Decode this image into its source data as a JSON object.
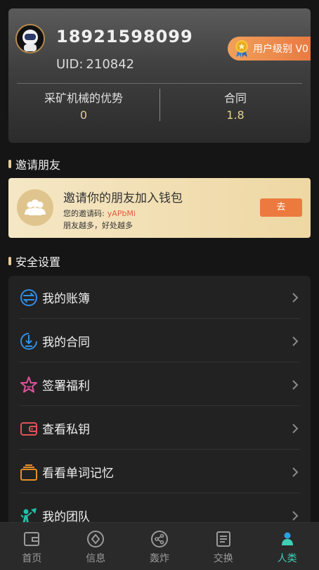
{
  "profile": {
    "phone": "18921598099",
    "uid_label": "UID:",
    "uid": "210842",
    "level_badge": "用户级别 V0",
    "stats": [
      {
        "title": "采矿机械的优势",
        "value": "0"
      },
      {
        "title": "合同",
        "value": "1.8"
      }
    ]
  },
  "invite_section": {
    "title": "邀请朋友",
    "headline": "邀请你的朋友加入钱包",
    "code_label": "您的邀请码:",
    "code": "yAPbMi",
    "note": "朋友越多，好处越多",
    "button": "去"
  },
  "security_section": {
    "title": "安全设置",
    "items": [
      {
        "label": "我的账簿",
        "icon": "ledger-icon",
        "color": "#2f8fe6"
      },
      {
        "label": "我的合同",
        "icon": "contract-icon",
        "color": "#2f8fe6"
      },
      {
        "label": "签署福利",
        "icon": "star-icon",
        "color": "#e0529c"
      },
      {
        "label": "查看私钥",
        "icon": "wallet-icon",
        "color": "#e0525a"
      },
      {
        "label": "看看单词记忆",
        "icon": "cards-icon",
        "color": "#e69027"
      },
      {
        "label": "我的团队",
        "icon": "team-icon",
        "color": "#20c0a6"
      }
    ]
  },
  "bottom_nav": {
    "items": [
      {
        "label": "首页",
        "icon": "home-icon"
      },
      {
        "label": "信息",
        "icon": "compass-icon"
      },
      {
        "label": "轰炸",
        "icon": "share-icon"
      },
      {
        "label": "交换",
        "icon": "document-icon"
      },
      {
        "label": "人类",
        "icon": "person-icon",
        "active": true
      }
    ],
    "active_color": "#3dd0b4"
  }
}
